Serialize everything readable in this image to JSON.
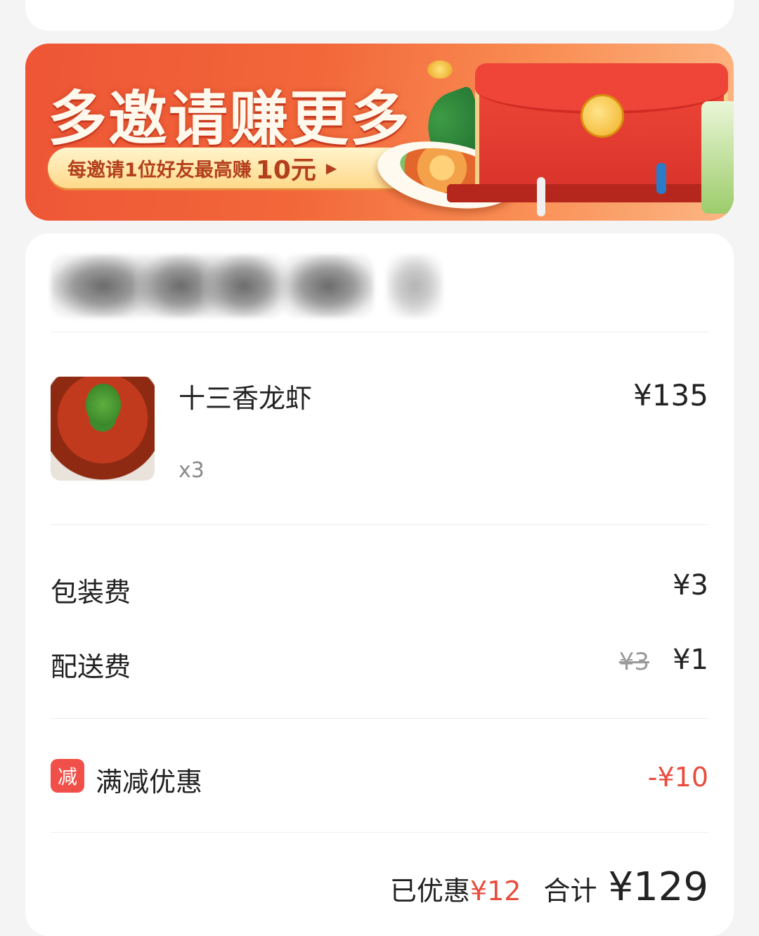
{
  "banner": {
    "title": "多邀请赚更多",
    "subtitle_prefix": "每邀请1位好友最高赚",
    "subtitle_amount": "10元",
    "arrow": "▶"
  },
  "order": {
    "item": {
      "name": "十三香龙虾",
      "quantity": "x3",
      "price": "¥135"
    },
    "fees": {
      "packaging_label": "包装费",
      "packaging_value": "¥3",
      "delivery_label": "配送费",
      "delivery_original": "¥3",
      "delivery_value": "¥1"
    },
    "discount": {
      "badge": "减",
      "label": "满减优惠",
      "value": "-¥10"
    },
    "summary": {
      "saved_label": "已优惠",
      "saved_value": "¥12",
      "total_label": "合计",
      "total_value": "¥129"
    }
  },
  "colors": {
    "accent_red": "#e84c3d",
    "badge_red": "#f1504a",
    "banner_orange": "#f2673a"
  }
}
